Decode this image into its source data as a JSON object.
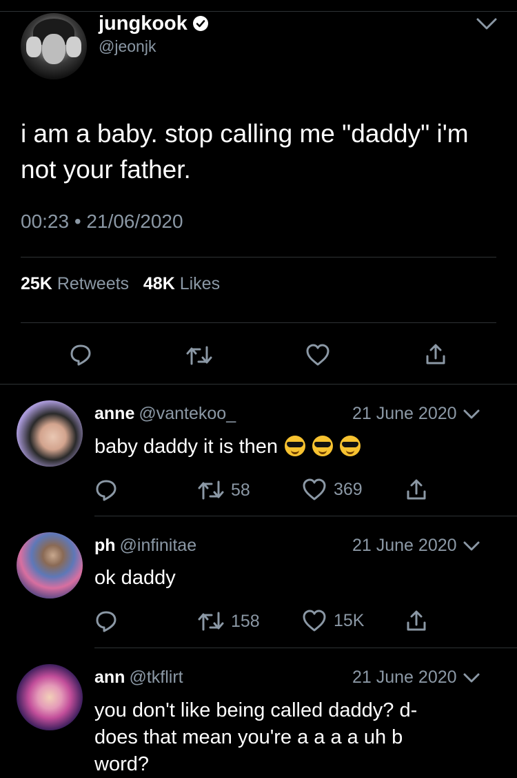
{
  "tweet": {
    "author_name": "jungkook",
    "author_handle": "@jeonjk",
    "text": "i am a baby. stop calling me \"daddy\" i'm not your father.",
    "timestamp": "00:23 • 21/06/2020",
    "retweets_count": "25K",
    "retweets_label": "Retweets",
    "likes_count": "48K",
    "likes_label": "Likes"
  },
  "replies": [
    {
      "name": "anne",
      "handle": "@vantekoo_",
      "date": "21 June 2020",
      "text": "baby daddy it is then",
      "emoji": [
        "sunglasses-emoji",
        "sunglasses-emoji",
        "sunglasses-emoji"
      ],
      "retweets": "58",
      "likes": "369"
    },
    {
      "name": "ph",
      "handle": "@infinitae",
      "date": "21 June 2020",
      "text": "ok daddy",
      "retweets": "158",
      "likes": "15K"
    },
    {
      "name": "ann",
      "handle": "@tkflirt",
      "date": "21 June 2020",
      "text": "you don't like being called daddy? d-does that mean you're a a a a uh b word?"
    }
  ],
  "colors": {
    "background": "#000000",
    "secondary_text": "#8b98a5",
    "divider": "#2f3336"
  }
}
